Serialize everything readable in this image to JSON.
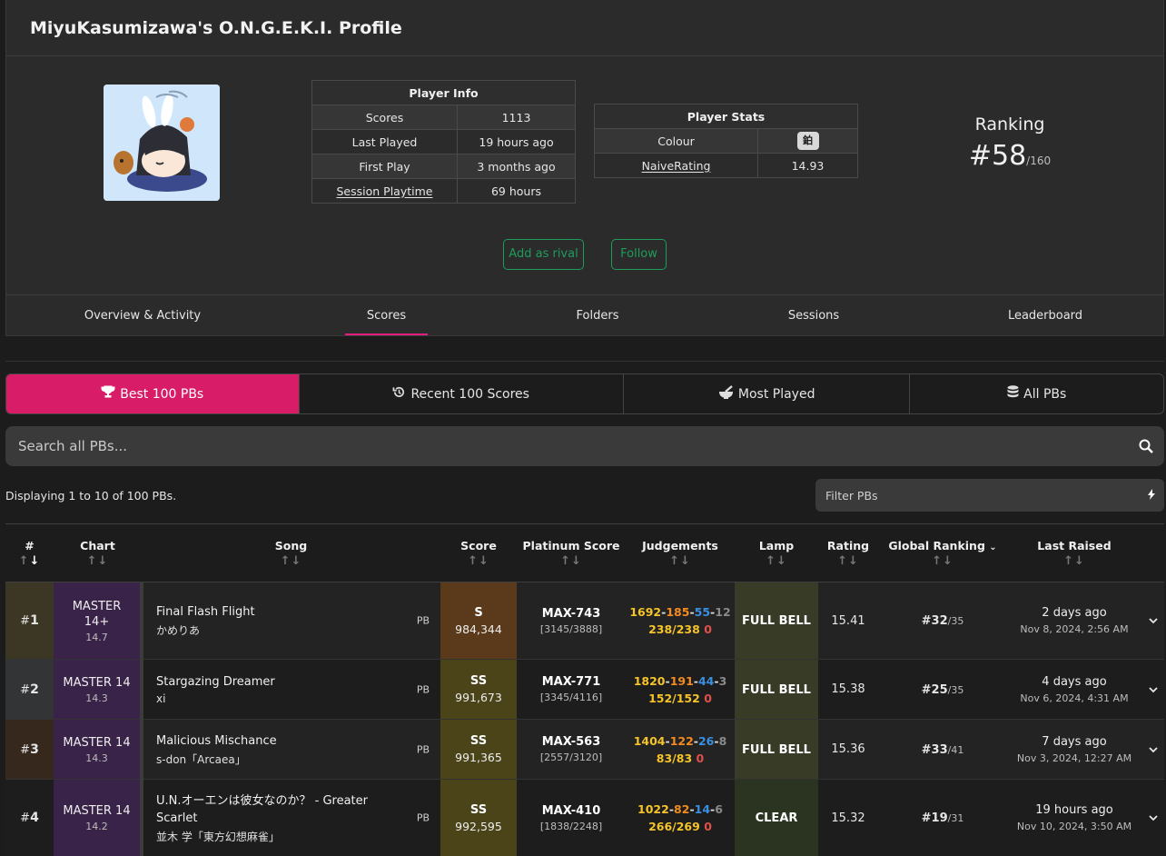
{
  "profile": {
    "title": "MiyuKasumizawa's O.N.G.E.K.I. Profile",
    "player_info": {
      "header": "Player Info",
      "rows": [
        {
          "label": "Scores",
          "value": "1113"
        },
        {
          "label": "Last Played",
          "value": "19 hours ago"
        },
        {
          "label": "First Play",
          "value": "3 months ago"
        },
        {
          "label": "Session Playtime",
          "value": "69 hours"
        }
      ]
    },
    "player_stats": {
      "header": "Player Stats",
      "colour_label": "Colour",
      "colour_value": "鉑",
      "rating_label": "NaiveRating",
      "rating_value": "14.93"
    },
    "ranking": {
      "label": "Ranking",
      "rank": "#58",
      "total": "/160"
    },
    "buttons": {
      "add_rival": "Add as rival",
      "follow": "Follow"
    },
    "tabs": [
      "Overview & Activity",
      "Scores",
      "Folders",
      "Sessions",
      "Leaderboard"
    ]
  },
  "selector": {
    "best": "Best 100 PBs",
    "recent": "Recent 100 Scores",
    "most": "Most Played",
    "all": "All PBs"
  },
  "search": {
    "placeholder": "Search all PBs..."
  },
  "display_count": "Displaying 1 to 10 of 100 PBs.",
  "filter": {
    "placeholder": "Filter PBs"
  },
  "columns": [
    "#",
    "Chart",
    "Song",
    "Score",
    "Platinum Score",
    "Judgements",
    "Lamp",
    "Rating",
    "Global Ranking",
    "Last Raised"
  ],
  "colors": {
    "accent": "#d81c68",
    "rival_green": "#1e9c5a",
    "master": "#3a2348"
  },
  "rows": [
    {
      "rank_prefix": "#",
      "rank": "1",
      "chart_line1": "MASTER",
      "chart_line2": "14+",
      "level": "14.7",
      "title": "Final Flash Flight",
      "artist": "かめりあ",
      "pb": "PB",
      "grade": "S",
      "score": "984,344",
      "plat": "MAX-743",
      "plat_sub": "[3145/3888]",
      "j1": "1692",
      "j2": "185",
      "j3": "55",
      "j4": "12",
      "bells": "238/238",
      "dmg": "0",
      "lamp": "FULL BELL",
      "rating": "15.41",
      "glob_rank": "#32",
      "glob_total": "/35",
      "raised_rel": "2 days ago",
      "raised_abs": "Nov 8, 2024, 2:56 AM"
    },
    {
      "rank_prefix": "#",
      "rank": "2",
      "chart_line1": "MASTER 14",
      "chart_line2": "",
      "level": "14.3",
      "title": "Stargazing Dreamer",
      "artist": "xi",
      "pb": "PB",
      "grade": "SS",
      "score": "991,673",
      "plat": "MAX-771",
      "plat_sub": "[3345/4116]",
      "j1": "1820",
      "j2": "191",
      "j3": "44",
      "j4": "3",
      "bells": "152/152",
      "dmg": "0",
      "lamp": "FULL BELL",
      "rating": "15.38",
      "glob_rank": "#25",
      "glob_total": "/35",
      "raised_rel": "4 days ago",
      "raised_abs": "Nov 6, 2024, 4:31 AM"
    },
    {
      "rank_prefix": "#",
      "rank": "3",
      "chart_line1": "MASTER 14",
      "chart_line2": "",
      "level": "14.3",
      "title": "Malicious Mischance",
      "artist": "s-don「Arcaea」",
      "pb": "PB",
      "grade": "SS",
      "score": "991,365",
      "plat": "MAX-563",
      "plat_sub": "[2557/3120]",
      "j1": "1404",
      "j2": "122",
      "j3": "26",
      "j4": "8",
      "bells": "83/83",
      "dmg": "0",
      "lamp": "FULL BELL",
      "rating": "15.36",
      "glob_rank": "#33",
      "glob_total": "/41",
      "raised_rel": "7 days ago",
      "raised_abs": "Nov 3, 2024, 12:27 AM"
    },
    {
      "rank_prefix": "#",
      "rank": "4",
      "chart_line1": "MASTER 14",
      "chart_line2": "",
      "level": "14.2",
      "title": "U.N.オーエンは彼女なのか？ - Greater Scarlet",
      "artist": "並木 学「東方幻想麻雀」",
      "pb": "PB",
      "grade": "SS",
      "score": "992,595",
      "plat": "MAX-410",
      "plat_sub": "[1838/2248]",
      "j1": "1022",
      "j2": "82",
      "j3": "14",
      "j4": "6",
      "bells": "266/269",
      "dmg": "0",
      "lamp": "CLEAR",
      "rating": "15.32",
      "glob_rank": "#19",
      "glob_total": "/31",
      "raised_rel": "19 hours ago",
      "raised_abs": "Nov 10, 2024, 3:50 AM"
    }
  ]
}
